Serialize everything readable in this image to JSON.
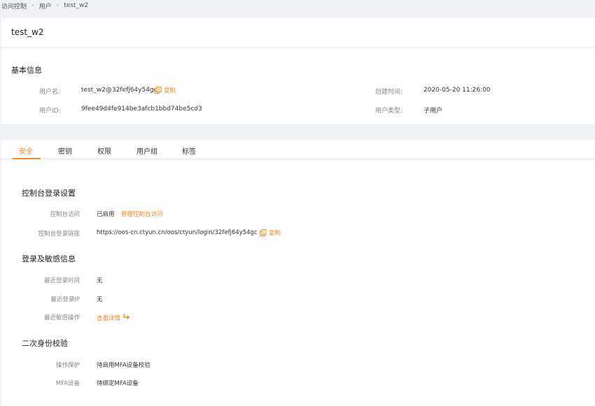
{
  "breadcrumb": {
    "items": [
      "访问控制",
      "用户",
      "test_w2"
    ]
  },
  "header": {
    "title": "test_w2"
  },
  "basic_info": {
    "section_title": "基本信息",
    "username_label": "用户名:",
    "username_value": "test_w2@32fefj64y54gc",
    "copy_label": "复制",
    "user_id_label": "用户ID:",
    "user_id_value": "9fee49d4fe914be3afcb1bbd74be5cd3",
    "created_label": "创建时间:",
    "created_value": "2020-05-20 11:26:00",
    "type_label": "用户类型:",
    "type_value": "子用户"
  },
  "tabs": [
    "安全",
    "密钥",
    "权限",
    "用户组",
    "标签"
  ],
  "console_login": {
    "section_title": "控制台登录设置",
    "access_label": "控制台访问",
    "access_value": "已启用",
    "access_manage_link": "管理控制台访问",
    "login_link_label": "控制台登录链接",
    "login_link_value": "https://oos-cn.ctyun.cn/oos/ctyun/login/32fefj64y54gc",
    "copy_label": "复制"
  },
  "login_sensitive": {
    "section_title": "登录及敏感信息",
    "last_login_time_label": "最近登录时间",
    "last_login_time_value": "无",
    "last_login_ip_label": "最近登录IP",
    "last_login_ip_value": "无",
    "last_sensitive_label": "最近敏感操作",
    "view_details_link": "查看详情"
  },
  "mfa": {
    "section_title": "二次身份校验",
    "protection_label": "操作保护",
    "protection_value": "待启用MFA设备校验",
    "device_label": "MFA设备",
    "device_value": "待绑定MFA设备"
  },
  "colors": {
    "accent": "#f08a24",
    "background": "#f0f2f5"
  }
}
